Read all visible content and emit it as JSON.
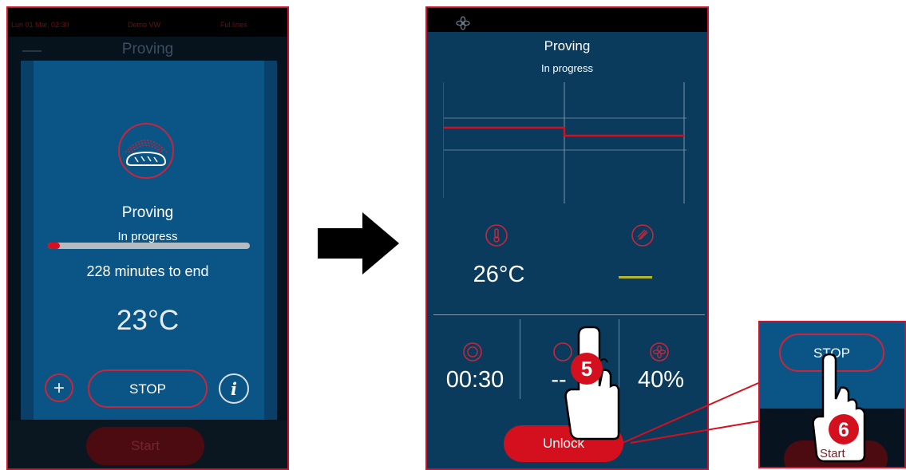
{
  "left_screen": {
    "statusbar": {
      "datetime": "Lun 01 Mar, 02:30",
      "center": "Demo VW",
      "right": "Ful.lines"
    },
    "background_title": "Proving",
    "background_start_label": "Start",
    "dialog": {
      "title": "Proving",
      "status": "In progress",
      "progress_percent": 6,
      "time_left": "228 minutes to end",
      "temperature": "23°C",
      "plus_label": "+",
      "stop_label": "STOP",
      "info_label": "i"
    }
  },
  "right_screen": {
    "title": "Proving",
    "status": "In progress",
    "temperature": "26°C",
    "humidity": "--",
    "timer": "00:30",
    "middle_value": "--",
    "fan_speed": "40%",
    "unlock_label": "Unlock"
  },
  "inset": {
    "stop_label": "STOP",
    "start_label": "Start"
  },
  "step_markers": {
    "step5": "5",
    "step6": "6"
  },
  "colors": {
    "accent_red": "#d5101e",
    "dialog_blue": "#0b5486",
    "screen_blue": "#0b3b5c"
  },
  "icons": {
    "left_dialog": "bread-icon",
    "right_metric1": "thermometer-icon",
    "right_metric2": "humidity-icon",
    "right_timer": "clock-icon",
    "right_fan": "fan-icon"
  }
}
